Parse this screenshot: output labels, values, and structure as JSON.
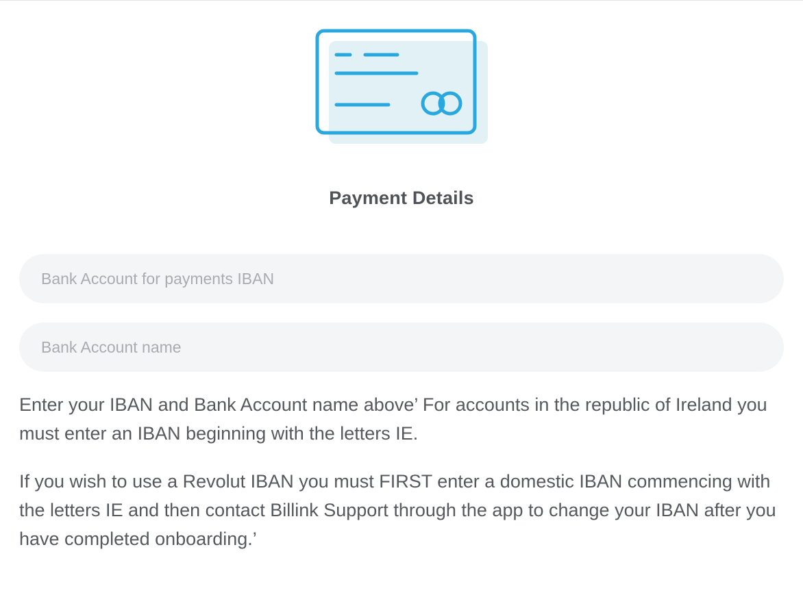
{
  "header": {
    "illustration_icon": "credit-card-icon",
    "title": "Payment Details"
  },
  "form": {
    "iban": {
      "value": "",
      "placeholder": "Bank Account for payments IBAN"
    },
    "account_name": {
      "value": "",
      "placeholder": "Bank Account name"
    }
  },
  "help": {
    "paragraph_1": "Enter your IBAN and Bank Account name above’ For accounts in the republic of Ireland you must enter an IBAN beginning with the letters IE.",
    "paragraph_2": "If you wish to use a Revolut IBAN you must FIRST enter a domestic IBAN commencing with the letters IE and then contact Billink Support through the app to change your IBAN after you have completed onboarding.’"
  },
  "colors": {
    "accent": "#29a8e0",
    "card_fill": "#e1f1f6",
    "field_bg": "#f4f5f7",
    "title_text": "#4f5357",
    "body_text": "#55595d",
    "placeholder_text": "#a8acb1"
  }
}
